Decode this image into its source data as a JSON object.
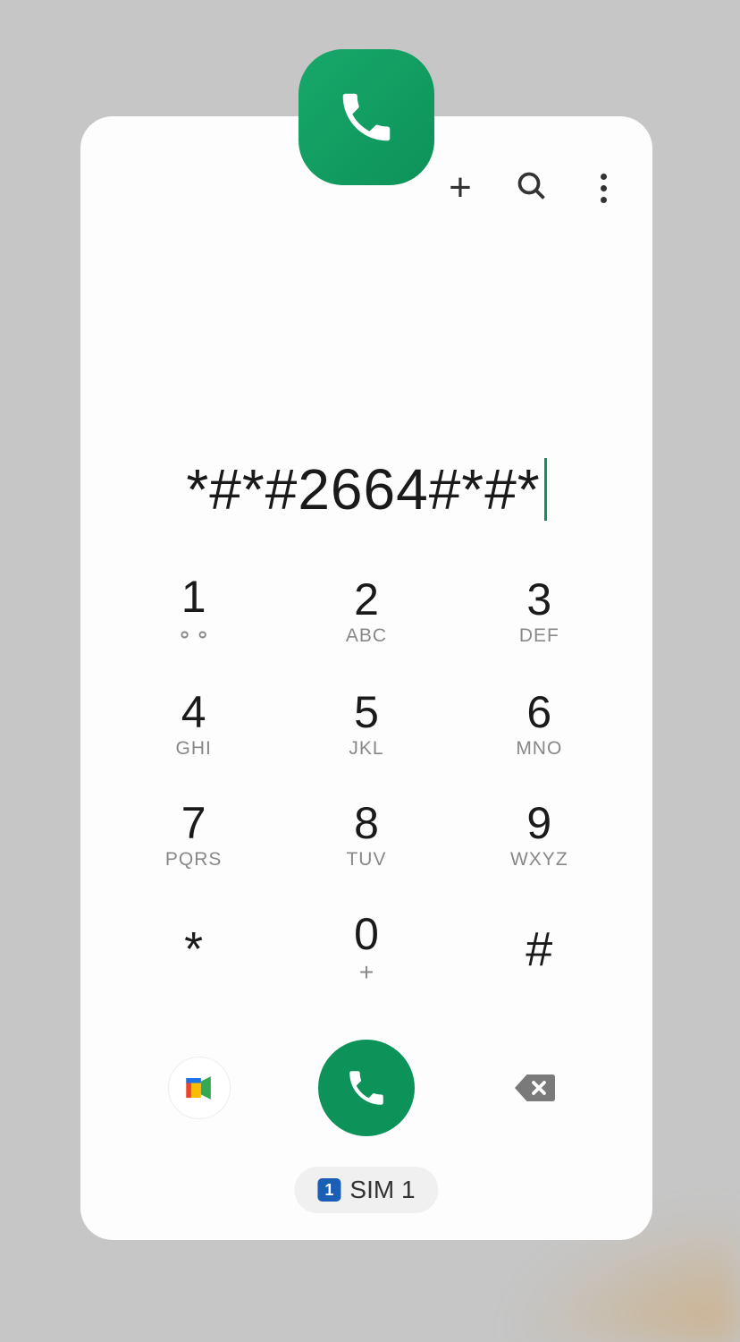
{
  "dialer": {
    "entered_number": "*#*#2664#*#*"
  },
  "keypad": {
    "keys": {
      "1": {
        "digit": "1",
        "sub": "voicemail"
      },
      "2": {
        "digit": "2",
        "sub": "ABC"
      },
      "3": {
        "digit": "3",
        "sub": "DEF"
      },
      "4": {
        "digit": "4",
        "sub": "GHI"
      },
      "5": {
        "digit": "5",
        "sub": "JKL"
      },
      "6": {
        "digit": "6",
        "sub": "MNO"
      },
      "7": {
        "digit": "7",
        "sub": "PQRS"
      },
      "8": {
        "digit": "8",
        "sub": "TUV"
      },
      "9": {
        "digit": "9",
        "sub": "WXYZ"
      },
      "star": {
        "digit": "*"
      },
      "0": {
        "digit": "0",
        "sub": "+"
      },
      "hash": {
        "digit": "#"
      }
    }
  },
  "sim": {
    "number": "1",
    "label": "SIM 1"
  },
  "colors": {
    "accent": "#0d9259",
    "sim_badge": "#1a5fb4"
  }
}
